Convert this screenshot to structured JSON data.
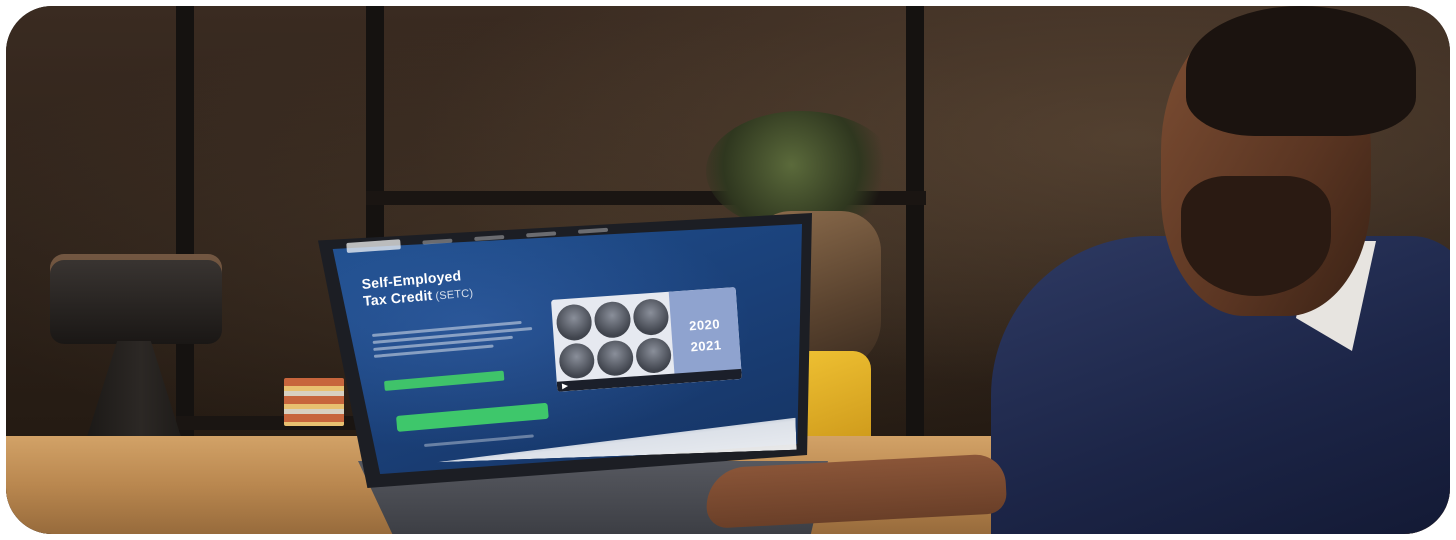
{
  "screen_page": {
    "title_line1": "Self-Employed",
    "title_line2": "Tax Credit",
    "title_suffix": "(SETC)",
    "video_year_1": "2020",
    "video_year_2": "2021"
  },
  "colors": {
    "screen_blue": "#1f4f8e",
    "cta_green": "#3ec76b",
    "chair_yellow": "#f0c233",
    "desk_wood": "#c7955b",
    "suit_navy": "#1c2547"
  },
  "icons": {
    "video_play": "play-icon"
  }
}
